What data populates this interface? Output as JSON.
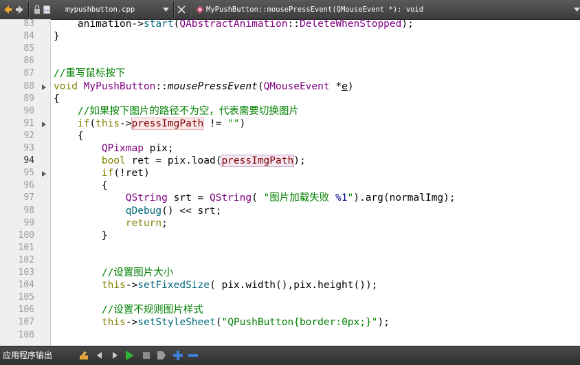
{
  "toolbar": {
    "file_name": "mypushbutton.cpp",
    "function_name": "MyPushButton::mousePressEvent(QMouseEvent *): void"
  },
  "editor": {
    "current_line": 94,
    "lines": [
      {
        "n": "83",
        "tokens": [
          [
            "pu",
            "    animation->"
          ],
          [
            "fn",
            "start"
          ],
          [
            "pu",
            "("
          ],
          [
            "ty",
            "QAbstractAnimation"
          ],
          [
            "pu",
            "::"
          ],
          [
            "ty",
            "DeleteWhenStopped"
          ],
          [
            "pu",
            ");"
          ]
        ]
      },
      {
        "n": "84",
        "tokens": [
          [
            "pu",
            "}"
          ]
        ]
      },
      {
        "n": "85",
        "tokens": []
      },
      {
        "n": "86",
        "tokens": []
      },
      {
        "n": "87",
        "tokens": [
          [
            "cm",
            "//重写鼠标按下"
          ]
        ]
      },
      {
        "n": "88",
        "fold": true,
        "tokens": [
          [
            "kw",
            "void"
          ],
          [
            "pu",
            " "
          ],
          [
            "ty",
            "MyPushButton"
          ],
          [
            "pu",
            "::"
          ],
          [
            "it",
            "mousePressEvent"
          ],
          [
            "pu",
            "("
          ],
          [
            "ty",
            "QMouseEvent"
          ],
          [
            "pu",
            " *"
          ],
          [
            "ul",
            "e"
          ],
          [
            "pu",
            ")"
          ]
        ]
      },
      {
        "n": "89",
        "tokens": [
          [
            "pu",
            "{"
          ]
        ]
      },
      {
        "n": "90",
        "tokens": [
          [
            "cm",
            "    //如果按下图片的路径不为空，代表需要切换图片"
          ]
        ]
      },
      {
        "n": "91",
        "fold": true,
        "tokens": [
          [
            "pu",
            "    "
          ],
          [
            "kw",
            "if"
          ],
          [
            "pu",
            "("
          ],
          [
            "kw",
            "this"
          ],
          [
            "pu",
            "->"
          ],
          [
            "hl",
            "pressImgPath"
          ],
          [
            "pu",
            " != "
          ],
          [
            "st",
            "\"\""
          ],
          [
            "pu",
            ")"
          ]
        ]
      },
      {
        "n": "92",
        "tokens": [
          [
            "pu",
            "    {"
          ]
        ]
      },
      {
        "n": "93",
        "tokens": [
          [
            "pu",
            "        "
          ],
          [
            "ty",
            "QPixmap"
          ],
          [
            "pu",
            " pix;"
          ]
        ]
      },
      {
        "n": "94",
        "tokens": [
          [
            "pu",
            "        "
          ],
          [
            "kw",
            "bool"
          ],
          [
            "pu",
            " ret = pix.load("
          ],
          [
            "hl2",
            "pressImgPath"
          ],
          [
            "pu",
            ");"
          ]
        ]
      },
      {
        "n": "95",
        "fold": true,
        "tokens": [
          [
            "pu",
            "        "
          ],
          [
            "kw",
            "if"
          ],
          [
            "pu",
            "(!ret)"
          ]
        ]
      },
      {
        "n": "96",
        "tokens": [
          [
            "pu",
            "        {"
          ]
        ]
      },
      {
        "n": "97",
        "tokens": [
          [
            "pu",
            "            "
          ],
          [
            "ty",
            "QString"
          ],
          [
            "pu",
            " srt = "
          ],
          [
            "ty",
            "QString"
          ],
          [
            "pu",
            "( "
          ],
          [
            "st",
            "\"图片加载失败 "
          ],
          [
            "nm",
            "%1"
          ],
          [
            "st",
            "\""
          ],
          [
            "pu",
            ").arg(normalImg);"
          ]
        ]
      },
      {
        "n": "98",
        "tokens": [
          [
            "pu",
            "            "
          ],
          [
            "fn",
            "qDebug"
          ],
          [
            "pu",
            "() << srt;"
          ]
        ]
      },
      {
        "n": "99",
        "tokens": [
          [
            "pu",
            "            "
          ],
          [
            "kw",
            "return"
          ],
          [
            "pu",
            ";"
          ]
        ]
      },
      {
        "n": "100",
        "tokens": [
          [
            "pu",
            "        }"
          ]
        ]
      },
      {
        "n": "101",
        "tokens": []
      },
      {
        "n": "102",
        "tokens": []
      },
      {
        "n": "103",
        "tokens": [
          [
            "cm",
            "        //设置图片大小"
          ]
        ]
      },
      {
        "n": "104",
        "tokens": [
          [
            "pu",
            "        "
          ],
          [
            "kw",
            "this"
          ],
          [
            "pu",
            "->"
          ],
          [
            "fn",
            "setFixedSize"
          ],
          [
            "pu",
            "( pix.width(),pix.height());"
          ]
        ]
      },
      {
        "n": "105",
        "tokens": []
      },
      {
        "n": "106",
        "tokens": [
          [
            "cm",
            "        //设置不规则图片样式"
          ]
        ]
      },
      {
        "n": "107",
        "tokens": [
          [
            "pu",
            "        "
          ],
          [
            "kw",
            "this"
          ],
          [
            "pu",
            "->"
          ],
          [
            "fn",
            "setStyleSheet"
          ],
          [
            "pu",
            "("
          ],
          [
            "st",
            "\"QPushButton{border:0px;}\""
          ],
          [
            "pu",
            ");"
          ]
        ]
      },
      {
        "n": "108",
        "tokens": []
      }
    ]
  },
  "bottom": {
    "output_label": "应用程序输出"
  },
  "colors": {
    "keyword": "#808000",
    "type": "#800080",
    "comment": "#008000",
    "string": "#008000"
  }
}
